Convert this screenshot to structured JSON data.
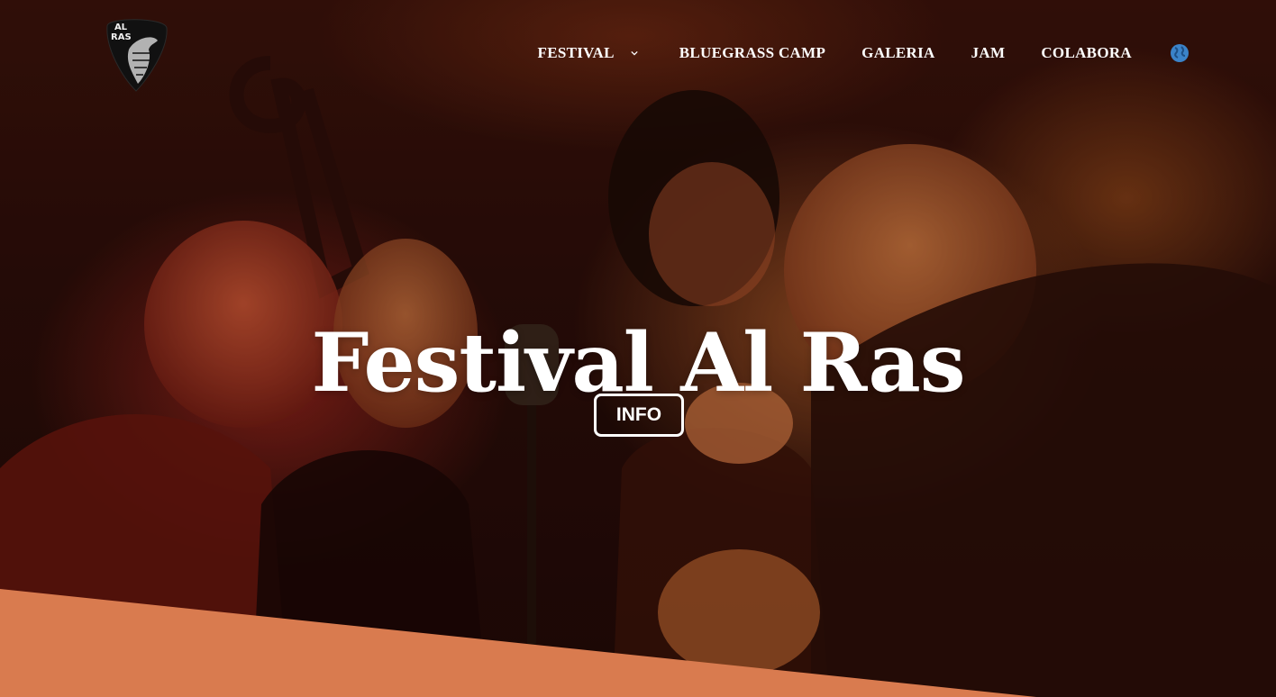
{
  "brand": {
    "logo_text": "AL RAS",
    "logo_icon": "guitar-pick-goat-logo"
  },
  "nav": {
    "items": [
      {
        "label": "FESTIVAL",
        "has_dropdown": true
      },
      {
        "label": "BLUEGRASS CAMP"
      },
      {
        "label": "GALERIA"
      },
      {
        "label": "JAM"
      },
      {
        "label": "COLABORA"
      }
    ],
    "language_icon": "globe-icon"
  },
  "hero": {
    "title": "Festival Al Ras",
    "button_label": "INFO"
  },
  "colors": {
    "accent_wedge": "#d97b4f",
    "globe": "#3b83c9",
    "text": "#ffffff"
  }
}
